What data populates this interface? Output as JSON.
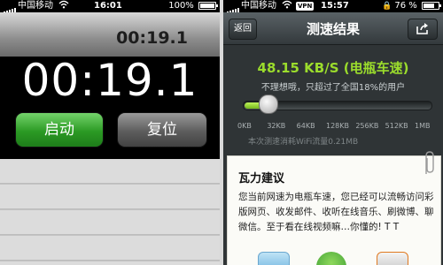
{
  "left_phone": {
    "status": {
      "carrier": "中国移动",
      "time": "16:01",
      "battery": "100%"
    },
    "lap_time": "00:19.1",
    "main_time": "00:19.1",
    "start_label": "启动",
    "reset_label": "复位"
  },
  "right_phone": {
    "status": {
      "carrier": "中国移动",
      "vpn": "VPN",
      "time": "15:57",
      "battery": "76 %",
      "battery_level": 0.76
    },
    "nav": {
      "back_label": "返回",
      "title": "测速结果",
      "share_icon": "share-icon"
    },
    "result": {
      "speed": "48.15 KB/S (电瓶车速)",
      "note": "不理想哦，只超过了全国18%的用户",
      "meter_level": 0.13,
      "ticks": [
        "0KB",
        "32KB",
        "64KB",
        "128KB",
        "256KB",
        "512KB",
        "1MB"
      ],
      "data_note": "本次测速消耗WiFi流量0.21MB"
    },
    "card": {
      "title": "瓦力建议",
      "body": "您当前网速为电瓶车速，您已经可以流畅访问彩版网页、收发邮件、收听在线音乐、刷微博、聊微信。至于看在线视频嘛…你懂的! T T"
    }
  },
  "colors": {
    "speed_green": "#9bdc2c",
    "start_green": "#2b9a24"
  }
}
